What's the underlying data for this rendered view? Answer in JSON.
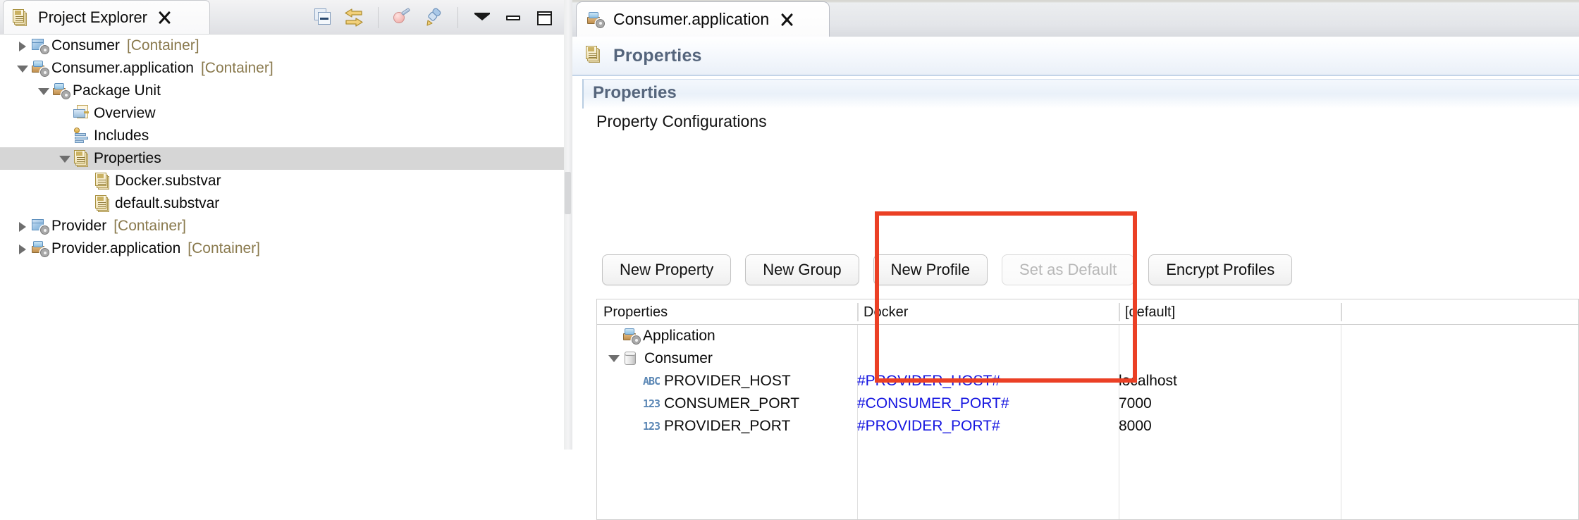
{
  "explorer": {
    "tab_title": "Project Explorer",
    "close_icon": "close-icon",
    "toolbar": [
      {
        "name": "collapse-all-icon",
        "tooltip": "Collapse All"
      },
      {
        "name": "link-with-editor-icon",
        "tooltip": "Link with Editor"
      },
      {
        "name": "build-icon",
        "tooltip": "Build"
      },
      {
        "name": "marker-icon",
        "tooltip": "Highlight"
      },
      {
        "name": "view-menu-icon",
        "tooltip": "View Menu"
      },
      {
        "name": "minimize-icon",
        "tooltip": "Minimize"
      },
      {
        "name": "maximize-icon",
        "tooltip": "Maximize"
      }
    ],
    "tree": [
      {
        "label": "Consumer",
        "suffix": "[Container]",
        "icon": "cube-gear-icon",
        "twisty": "right",
        "indent": 0,
        "selected": false
      },
      {
        "label": "Consumer.application",
        "suffix": "[Container]",
        "icon": "package-gear-icon",
        "twisty": "down",
        "indent": 0,
        "selected": false
      },
      {
        "label": "Package Unit",
        "suffix": "",
        "icon": "package-gear-icon",
        "twisty": "down",
        "indent": 1,
        "selected": false
      },
      {
        "label": "Overview",
        "suffix": "",
        "icon": "overview-icon",
        "twisty": "none",
        "indent": 2,
        "selected": false
      },
      {
        "label": "Includes",
        "suffix": "",
        "icon": "includes-icon",
        "twisty": "none",
        "indent": 2,
        "selected": false
      },
      {
        "label": "Properties",
        "suffix": "",
        "icon": "properties-icon",
        "twisty": "down",
        "indent": 2,
        "selected": true
      },
      {
        "label": "Docker.substvar",
        "suffix": "",
        "icon": "substvar-icon",
        "twisty": "none",
        "indent": 3,
        "selected": false
      },
      {
        "label": "default.substvar",
        "suffix": "",
        "icon": "substvar-icon",
        "twisty": "none",
        "indent": 3,
        "selected": false
      },
      {
        "label": "Provider",
        "suffix": "[Container]",
        "icon": "cube-gear-icon",
        "twisty": "right",
        "indent": 0,
        "selected": false
      },
      {
        "label": "Provider.application",
        "suffix": "[Container]",
        "icon": "package-gear-icon",
        "twisty": "right",
        "indent": 0,
        "selected": false
      }
    ]
  },
  "editor": {
    "tab_title": "Consumer.application",
    "tab_icon": "package-gear-icon",
    "close_icon": "close-icon",
    "form_title": "Properties",
    "form_icon": "properties-icon",
    "section_title": "Properties",
    "section_subtitle": "Property Configurations",
    "buttons": [
      {
        "label": "New Property",
        "enabled": true
      },
      {
        "label": "New Group",
        "enabled": true
      },
      {
        "label": "New Profile",
        "enabled": true
      },
      {
        "label": "Set as Default",
        "enabled": false
      },
      {
        "label": "Encrypt Profiles",
        "enabled": true
      }
    ],
    "table": {
      "columns": [
        "Properties",
        "Docker",
        "[default]",
        ""
      ],
      "rows": [
        {
          "name": "Application",
          "icon": "package-gear-icon",
          "twisty": "none",
          "indent": 0,
          "docker": "",
          "default": ""
        },
        {
          "name": "Consumer",
          "icon": "cylinder-icon",
          "twisty": "down",
          "indent": 0,
          "docker": "",
          "default": ""
        },
        {
          "name": "PROVIDER_HOST",
          "icon": "abc-type-icon",
          "twisty": "none",
          "indent": 1,
          "docker": "#PROVIDER_HOST#",
          "default": "localhost"
        },
        {
          "name": "CONSUMER_PORT",
          "icon": "123-type-icon",
          "twisty": "none",
          "indent": 1,
          "docker": "#CONSUMER_PORT#",
          "default": "7000"
        },
        {
          "name": "PROVIDER_PORT",
          "icon": "123-type-icon",
          "twisty": "none",
          "indent": 1,
          "docker": "#PROVIDER_PORT#",
          "default": "8000"
        }
      ]
    }
  },
  "annotation": {
    "name": "docker-column-highlight",
    "color": "#eb4025"
  }
}
